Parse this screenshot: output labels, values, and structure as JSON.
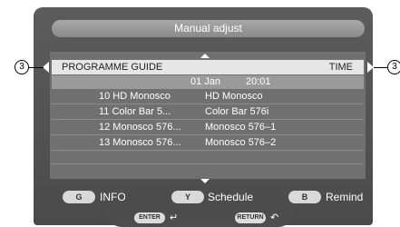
{
  "dialog": {
    "title": "Manual adjust"
  },
  "callouts": {
    "left": "3",
    "right": "3"
  },
  "header": {
    "left": "PROGRAMME GUIDE",
    "right": "TIME"
  },
  "date_row": {
    "date": "01 Jan",
    "time": "20:01"
  },
  "programmes": [
    {
      "channel": "10 HD Monosco",
      "title": "HD Monosco"
    },
    {
      "channel": "11 Color Bar 5...",
      "title": "Color Bar 576i"
    },
    {
      "channel": "12 Monosco 576...",
      "title": "Monosco 576–1"
    },
    {
      "channel": "13 Monosco 576...",
      "title": "Monosco 576–2"
    }
  ],
  "footer": {
    "info_key": "G",
    "info_label": "INFO",
    "schedule_key": "Y",
    "schedule_label": "Schedule",
    "remind_key": "B",
    "remind_label": "Remind",
    "enter_label": "ENTER",
    "enter_icon": "↵",
    "return_label": "RETURN",
    "return_icon": "↶"
  }
}
